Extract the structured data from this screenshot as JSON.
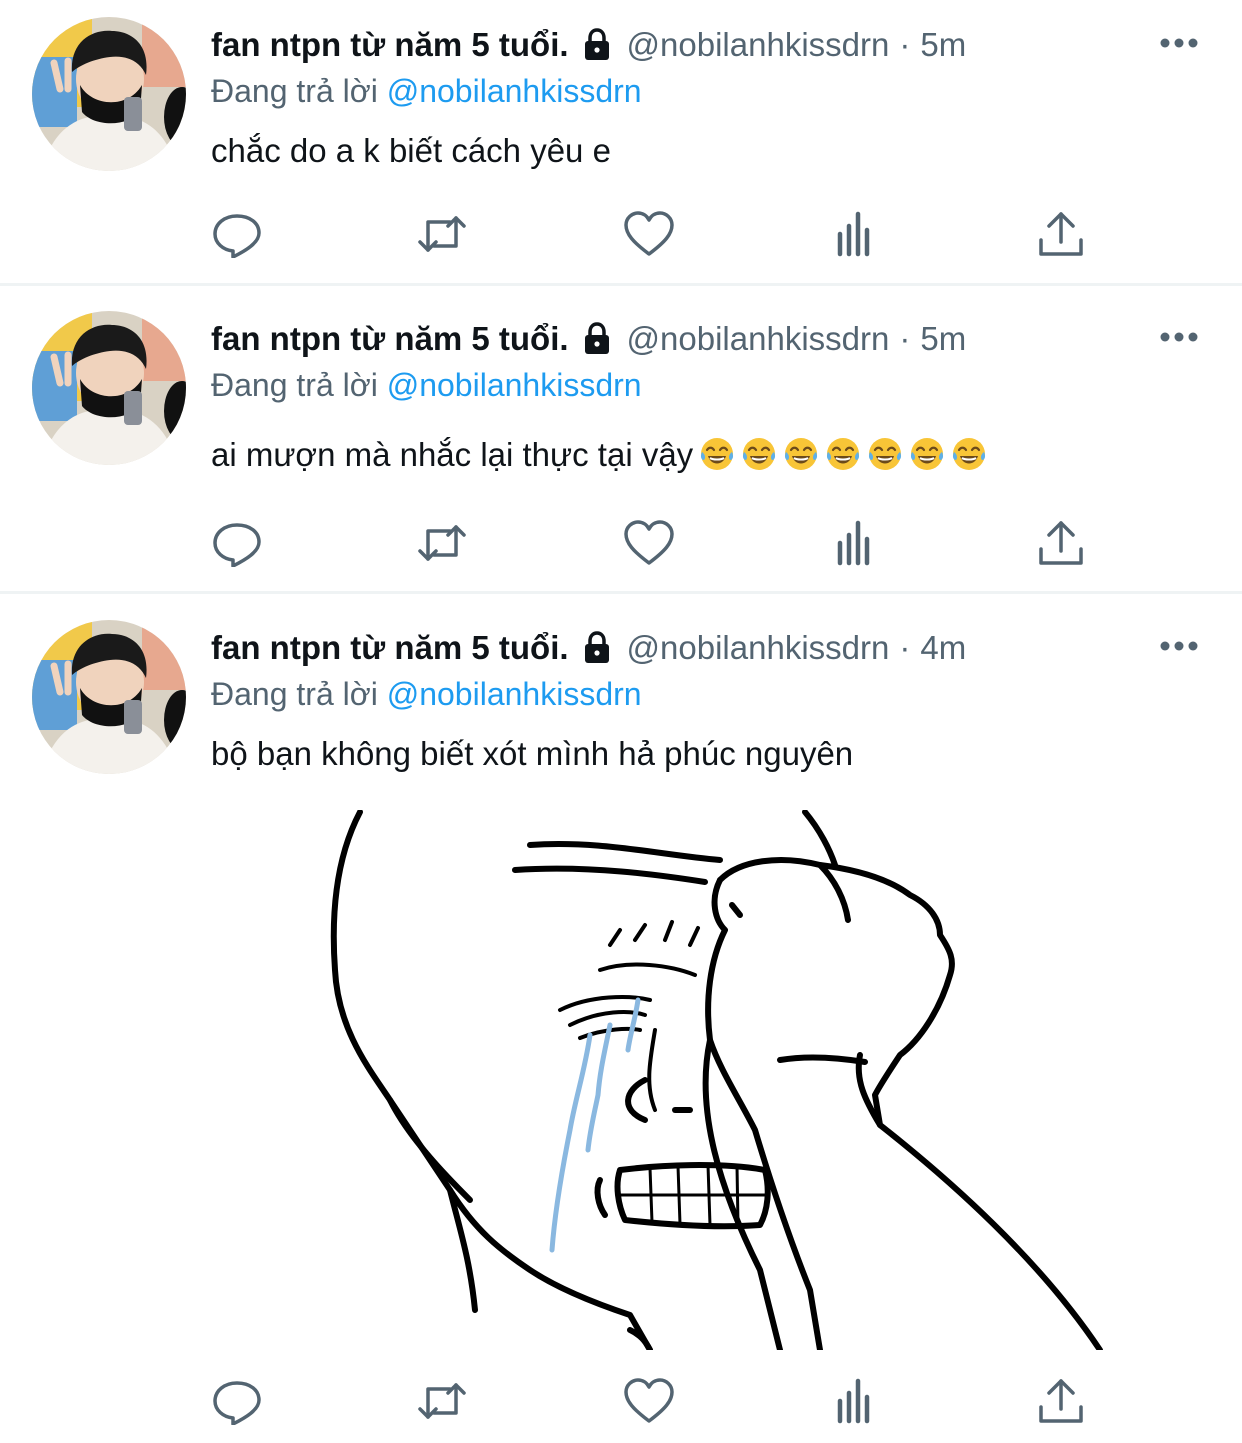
{
  "tweets": [
    {
      "author": {
        "name": "fan ntpn từ năm 5 tuổi.",
        "handle": "@nobilanhkissdrn",
        "protected": true
      },
      "time": "5m",
      "reply_prefix": "Đang trả lời",
      "reply_to": "@nobilanhkissdrn",
      "text": "chắc do a k biết cách yêu e",
      "emoji_count": 0,
      "has_media": false
    },
    {
      "author": {
        "name": "fan ntpn từ năm 5 tuổi.",
        "handle": "@nobilanhkissdrn",
        "protected": true
      },
      "time": "5m",
      "reply_prefix": "Đang trả lời",
      "reply_to": "@nobilanhkissdrn",
      "text": "ai mượn mà nhắc lại thực tại vậy",
      "emoji_count": 7,
      "emoji_name": "face-with-tears-of-joy",
      "has_media": false
    },
    {
      "author": {
        "name": "fan ntpn từ năm 5 tuổi.",
        "handle": "@nobilanhkissdrn",
        "protected": true
      },
      "time": "4m",
      "reply_prefix": "Đang trả lời",
      "reply_to": "@nobilanhkissdrn",
      "text": "bộ bạn không biết xót mình hả phúc nguyên",
      "emoji_count": 0,
      "has_media": true,
      "media": {
        "kind": "meme-drawing",
        "subject": "crying-wojak-facepalm"
      }
    }
  ],
  "separator": "·",
  "icons": {
    "more": "more-horizontal-icon",
    "lock": "lock-icon",
    "reply": "reply-bubble-icon",
    "retweet": "retweet-icon",
    "like": "heart-icon",
    "analytics": "analytics-bars-icon",
    "share": "share-upload-icon"
  },
  "colors": {
    "text": "#0f1419",
    "secondary": "#536471",
    "link": "#1d9bf0",
    "divider": "#eff3f4",
    "tear": "#8ab8e0"
  }
}
